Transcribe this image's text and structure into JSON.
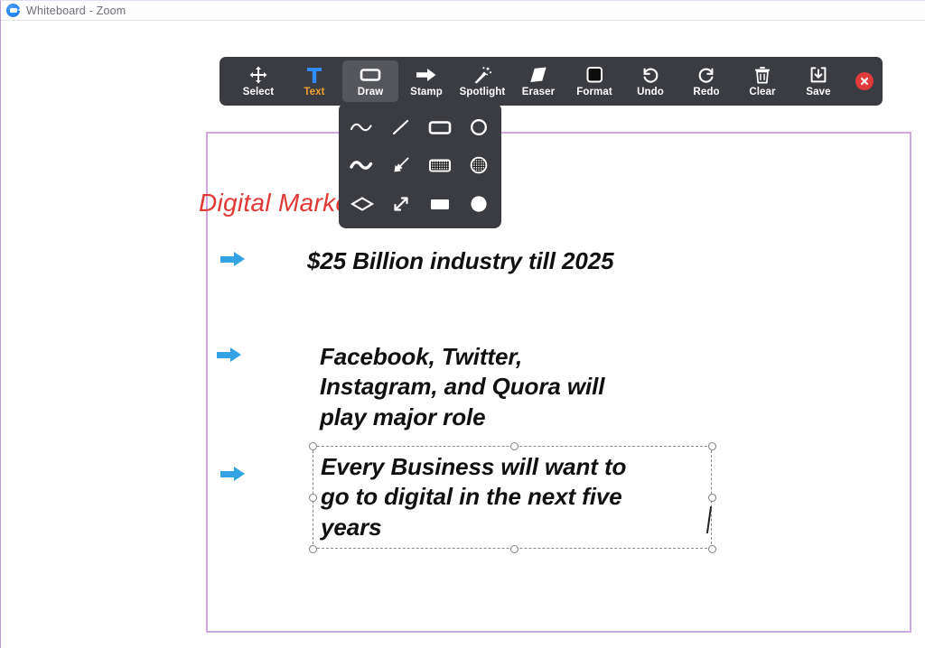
{
  "window": {
    "title": "Whiteboard - Zoom",
    "logo_icon": "zoom-camera-icon"
  },
  "toolbar": {
    "items": [
      {
        "label": "Select",
        "icon": "move-arrows-icon",
        "active": false,
        "accent": false
      },
      {
        "label": "Text",
        "icon": "text-t-icon",
        "active": false,
        "accent": true
      },
      {
        "label": "Draw",
        "icon": "rectangle-icon",
        "active": true,
        "accent": false
      },
      {
        "label": "Stamp",
        "icon": "arrow-right-icon",
        "active": false,
        "accent": false
      },
      {
        "label": "Spotlight",
        "icon": "magic-wand-icon",
        "active": false,
        "accent": false
      },
      {
        "label": "Eraser",
        "icon": "eraser-diamond-icon",
        "active": false,
        "accent": false
      },
      {
        "label": "Format",
        "icon": "color-swatch-icon",
        "active": false,
        "accent": false
      },
      {
        "label": "Undo",
        "icon": "undo-arrow-icon",
        "active": false,
        "accent": false
      },
      {
        "label": "Redo",
        "icon": "redo-arrow-icon",
        "active": false,
        "accent": false
      },
      {
        "label": "Clear",
        "icon": "trash-can-icon",
        "active": false,
        "accent": false
      },
      {
        "label": "Save",
        "icon": "save-download-icon",
        "active": false,
        "accent": false
      }
    ],
    "close_icon": "close-x-icon",
    "close_color": "#e03a3a",
    "background_color": "#3b3c41",
    "active_color": "#55565c",
    "accent_color": "#f0a030"
  },
  "draw_dropdown": {
    "open": true,
    "options": [
      {
        "icon": "squiggle-pen-icon"
      },
      {
        "icon": "line-icon"
      },
      {
        "icon": "rectangle-outline-icon"
      },
      {
        "icon": "circle-outline-icon"
      },
      {
        "icon": "squiggle-highlighter-icon"
      },
      {
        "icon": "thick-arrow-icon"
      },
      {
        "icon": "rectangle-hatched-icon"
      },
      {
        "icon": "circle-hatched-icon"
      },
      {
        "icon": "diamond-outline-icon"
      },
      {
        "icon": "double-arrow-icon"
      },
      {
        "icon": "rectangle-filled-icon"
      },
      {
        "icon": "circle-filled-icon"
      }
    ]
  },
  "whiteboard": {
    "border_color": "#cfa8dd",
    "slide_title": "Digital Marketing",
    "slide_title_color": "#e03a36",
    "bullet_arrow_color": "#34a3e3",
    "bullets": [
      {
        "text": "$25 Billion industry till 2025"
      },
      {
        "text": "Facebook, Twitter,\nInstagram, and Quora will\nplay major role"
      }
    ],
    "selected_textbox": {
      "text": "Every Business will want to\ngo to digital in the next five\nyears",
      "selected": true,
      "handle_count": 8
    }
  }
}
